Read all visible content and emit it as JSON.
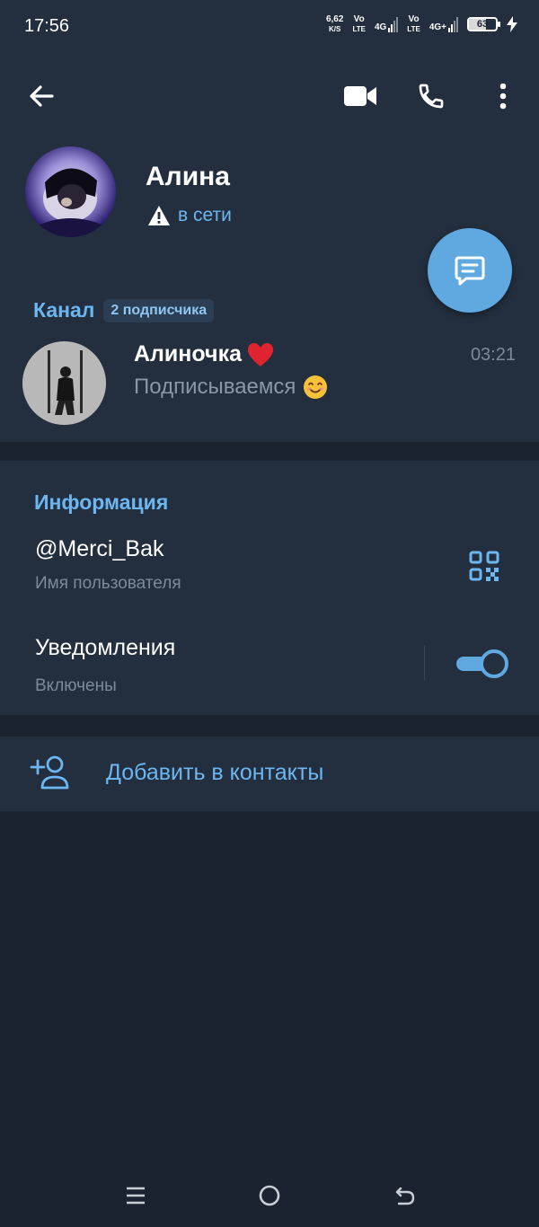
{
  "status_bar": {
    "time": "17:56",
    "net_speed_value": "6,62",
    "net_speed_unit": "K/S",
    "sim1_top": "Vo",
    "sim1_bottom": "LTE",
    "sim1_net": "4G",
    "sim2_top": "Vo",
    "sim2_bottom": "LTE",
    "sim2_net": "4G+",
    "battery_level": "63"
  },
  "profile": {
    "name": "Алина",
    "status": "в сети"
  },
  "channel": {
    "section_title": "Канал",
    "subscribers_badge": "2 подписчика",
    "name": "Алиночка",
    "time": "03:21",
    "last_message": "Подписываемся"
  },
  "info": {
    "section_title": "Информация",
    "username": "@Merci_Bak",
    "username_label": "Имя пользователя",
    "notifications_title": "Уведомления",
    "notifications_status": "Включены",
    "notifications_on": true
  },
  "actions": {
    "add_contact": "Добавить в контакты"
  },
  "colors": {
    "accent": "#6cb6f2",
    "fab": "#5fa8e0",
    "panel": "#232f3e",
    "background": "#1b2330"
  }
}
